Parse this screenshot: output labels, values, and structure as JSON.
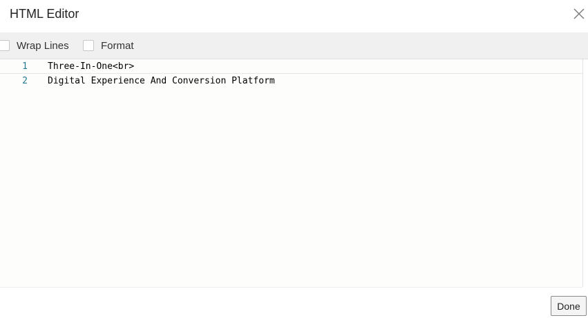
{
  "dialog": {
    "title": "HTML Editor",
    "close_icon": "close-icon"
  },
  "toolbar": {
    "wrap_lines_label": "Wrap Lines",
    "format_label": "Format",
    "wrap_lines_checked": false,
    "format_checked": false
  },
  "editor": {
    "lines": [
      {
        "number": "1",
        "text": "Three-In-One<br>"
      },
      {
        "number": "2",
        "text": "Digital Experience And Conversion Platform"
      }
    ]
  },
  "footer": {
    "done_label": "Done"
  }
}
